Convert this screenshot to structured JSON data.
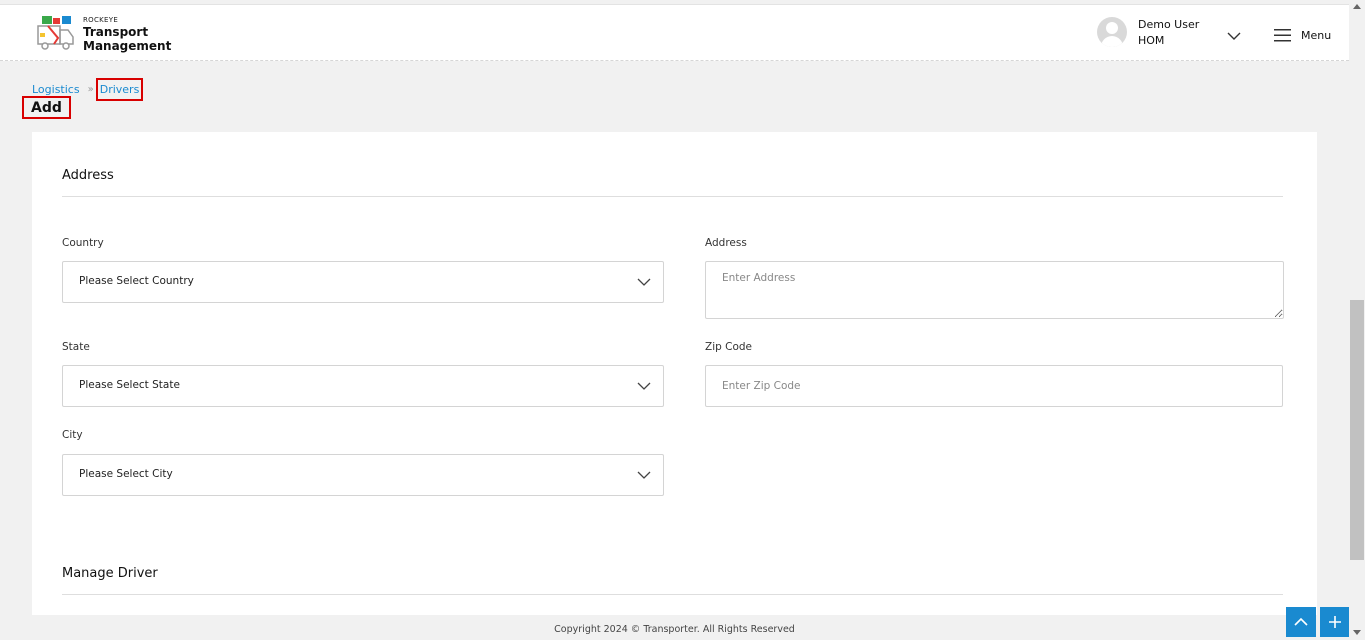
{
  "header": {
    "brand_small": "ROCKEYE",
    "brand_title_line1": "Transport",
    "brand_title_line2": "Management",
    "user_name": "Demo User",
    "user_org": "HOM",
    "menu_label": "Menu"
  },
  "breadcrumb": {
    "items": [
      {
        "label": "Logistics"
      },
      {
        "label": "Drivers"
      }
    ]
  },
  "page": {
    "title": "Add"
  },
  "address_section": {
    "title": "Address",
    "country": {
      "label": "Country",
      "value": "Please Select Country"
    },
    "state": {
      "label": "State",
      "value": "Please Select State"
    },
    "city": {
      "label": "City",
      "value": "Please Select City"
    },
    "address": {
      "label": "Address",
      "placeholder": "Enter Address"
    },
    "zip": {
      "label": "Zip Code",
      "placeholder": "Enter Zip Code"
    }
  },
  "manage_section": {
    "title": "Manage Driver"
  },
  "footer": {
    "copyright": "Copyright 2024 © Transporter. All Rights Reserved"
  },
  "colors": {
    "accent": "#1a8ad0",
    "highlight": "#d80000",
    "background": "#f1f1f1"
  },
  "icons": {
    "logo": "truck-logo-icon",
    "user": "user-avatar-icon",
    "chevron": "chevron-down-icon",
    "menu": "hamburger-menu-icon",
    "breadcrumb_separator": "double-chevron-right-icon",
    "scroll_top": "chevron-up-icon",
    "add": "plus-icon"
  }
}
